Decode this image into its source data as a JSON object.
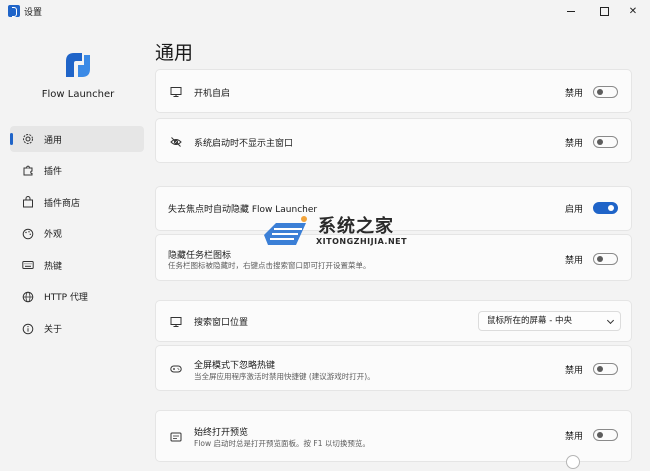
{
  "window": {
    "title": "设置"
  },
  "sidebar": {
    "app_name": "Flow Launcher",
    "items": [
      {
        "label": "通用",
        "icon": "gear-icon",
        "active": true
      },
      {
        "label": "插件",
        "icon": "puzzle-icon",
        "active": false
      },
      {
        "label": "插件商店",
        "icon": "store-icon",
        "active": false
      },
      {
        "label": "外观",
        "icon": "palette-icon",
        "active": false
      },
      {
        "label": "热键",
        "icon": "keyboard-icon",
        "active": false
      },
      {
        "label": "HTTP 代理",
        "icon": "globe-icon",
        "active": false
      },
      {
        "label": "关于",
        "icon": "info-icon",
        "active": false
      }
    ]
  },
  "main": {
    "title": "通用",
    "settings": [
      {
        "title": "开机自启",
        "state": "禁用",
        "on": false,
        "icon": "monitor-icon"
      },
      {
        "title": "系统启动时不显示主窗口",
        "state": "禁用",
        "on": false,
        "icon": "eye-off-icon"
      },
      {
        "title": "失去焦点时自动隐藏 Flow Launcher",
        "state": "启用",
        "on": true
      },
      {
        "title": "隐藏任务栏图标",
        "desc": "任务栏图标被隐藏时，右键点击搜索窗口即可打开设置菜单。",
        "state": "禁用",
        "on": false
      },
      {
        "title": "搜索窗口位置",
        "dropdown": "鼠标所在的屏幕 - 中央",
        "icon": "monitor-icon"
      },
      {
        "title": "全屏模式下忽略热键",
        "desc": "当全屏应用程序激活时禁用快捷键 (建议游戏时打开)。",
        "state": "禁用",
        "on": false,
        "icon": "gamepad-icon"
      },
      {
        "title": "始终打开预览",
        "desc": "Flow 启动时总是打开预览面板。按 F1 以切换预览。",
        "state": "禁用",
        "on": false,
        "icon": "preview-icon"
      }
    ]
  },
  "watermark": {
    "main": "系统之家",
    "sub": "XITONGZHIJIA.NET"
  },
  "colors": {
    "accent": "#1f64c8",
    "background": "#f3f3f3",
    "card": "#fbfbfb"
  }
}
